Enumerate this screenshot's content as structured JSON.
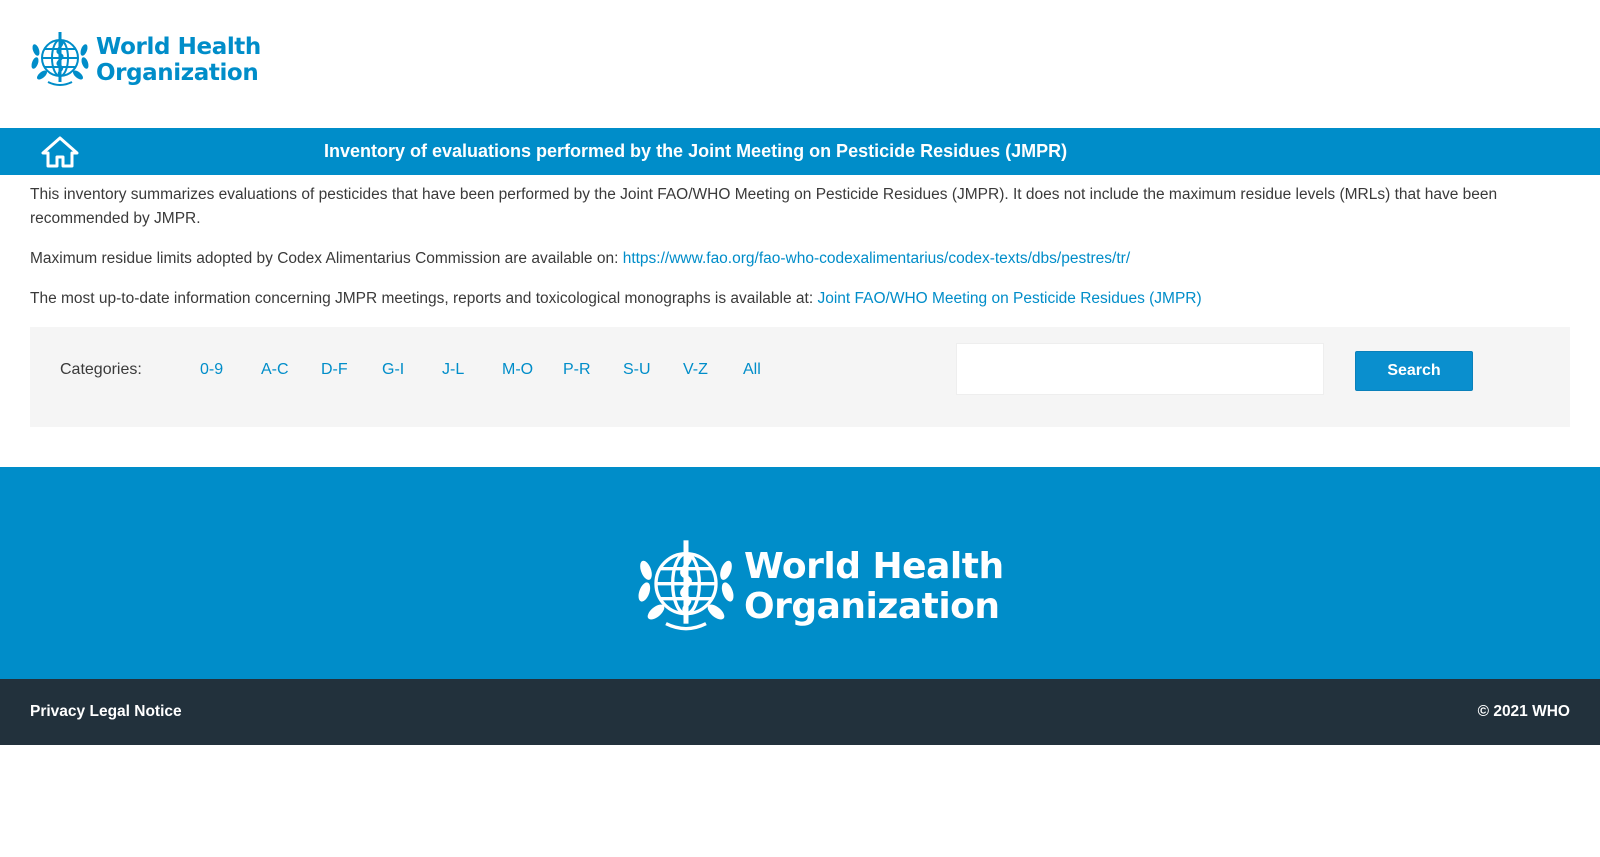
{
  "header": {
    "logo_line1": "World Health",
    "logo_line2": "Organization"
  },
  "nav": {
    "home_icon": "home-icon",
    "title": "Inventory of evaluations performed by the Joint Meeting on Pesticide Residues (JMPR)"
  },
  "content": {
    "intro": "This inventory summarizes evaluations of pesticides that have been performed by the Joint FAO/WHO Meeting on Pesticide Residues (JMPR). It does not include the maximum residue levels (MRLs) that have been recommended by JMPR.",
    "mrl_text": "Maximum residue limits adopted by Codex Alimentarius Commission are available on: ",
    "mrl_link": "https://www.fao.org/fao-who-codexalimentarius/codex-texts/dbs/pestres/tr/",
    "info_text": "The most up-to-date information concerning JMPR meetings, reports and toxicological monographs is available at: ",
    "info_link": "Joint FAO/WHO Meeting on Pesticide Residues (JMPR)"
  },
  "categories": {
    "label": "Categories:",
    "items": [
      "0-9",
      "A-C",
      "D-F",
      "G-I",
      "J-L",
      "M-O",
      "P-R",
      "S-U",
      "V-Z",
      "All"
    ]
  },
  "search": {
    "value": "",
    "button_label": "Search"
  },
  "footer": {
    "logo_line1": "World Health",
    "logo_line2": "Organization",
    "privacy": "Privacy",
    "legal": "Legal Notice",
    "copyright": "© 2021 WHO"
  },
  "colors": {
    "brand_blue": "#008dc9",
    "footer_dark": "#22313c"
  }
}
